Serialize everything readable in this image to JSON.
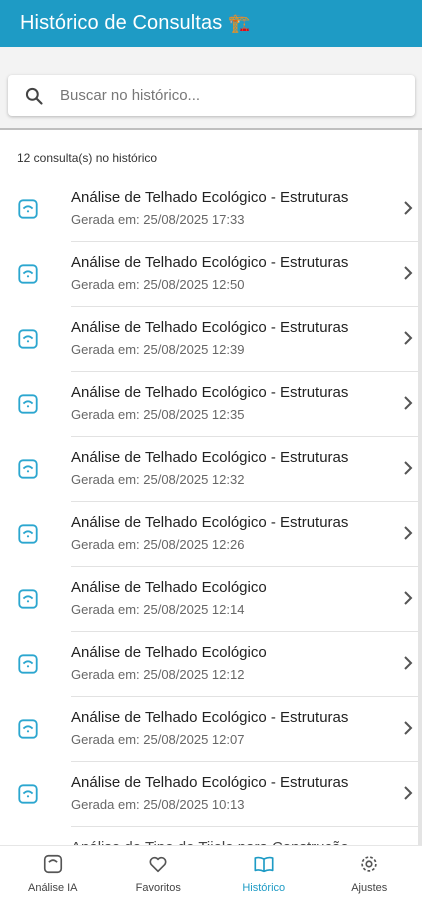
{
  "app_bar": {
    "title": "Histórico de Consultas",
    "emoji": "🏗️"
  },
  "search": {
    "placeholder": "Buscar no histórico..."
  },
  "history": {
    "count_text": "12 consulta(s) no histórico",
    "items": [
      {
        "title": "Análise de Telhado Ecológico - Estruturas",
        "subtitle": "Gerada em: 25/08/2025 17:33"
      },
      {
        "title": "Análise de Telhado Ecológico - Estruturas",
        "subtitle": "Gerada em: 25/08/2025 12:50"
      },
      {
        "title": "Análise de Telhado Ecológico - Estruturas",
        "subtitle": "Gerada em: 25/08/2025 12:39"
      },
      {
        "title": "Análise de Telhado Ecológico - Estruturas",
        "subtitle": "Gerada em: 25/08/2025 12:35"
      },
      {
        "title": "Análise de Telhado Ecológico - Estruturas",
        "subtitle": "Gerada em: 25/08/2025 12:32"
      },
      {
        "title": "Análise de Telhado Ecológico - Estruturas",
        "subtitle": "Gerada em: 25/08/2025 12:26"
      },
      {
        "title": "Análise de Telhado Ecológico",
        "subtitle": "Gerada em: 25/08/2025 12:14"
      },
      {
        "title": "Análise de Telhado Ecológico",
        "subtitle": "Gerada em: 25/08/2025 12:12"
      },
      {
        "title": "Análise de Telhado Ecológico - Estruturas",
        "subtitle": "Gerada em: 25/08/2025 12:07"
      },
      {
        "title": "Análise de Telhado Ecológico - Estruturas",
        "subtitle": "Gerada em: 25/08/2025 10:13"
      },
      {
        "title": "Análise de Tipo de Tijolo para Construção",
        "subtitle": ""
      }
    ]
  },
  "bottom_nav": {
    "items": [
      {
        "label": "Análise IA",
        "icon": "camera-icon",
        "active": false
      },
      {
        "label": "Favoritos",
        "icon": "heart-icon",
        "active": false
      },
      {
        "label": "Histórico",
        "icon": "book-icon",
        "active": true
      },
      {
        "label": "Ajustes",
        "icon": "gear-icon",
        "active": false
      }
    ]
  },
  "colors": {
    "primary": "#1e9bc5",
    "icon_accent": "#2ba6cf"
  }
}
